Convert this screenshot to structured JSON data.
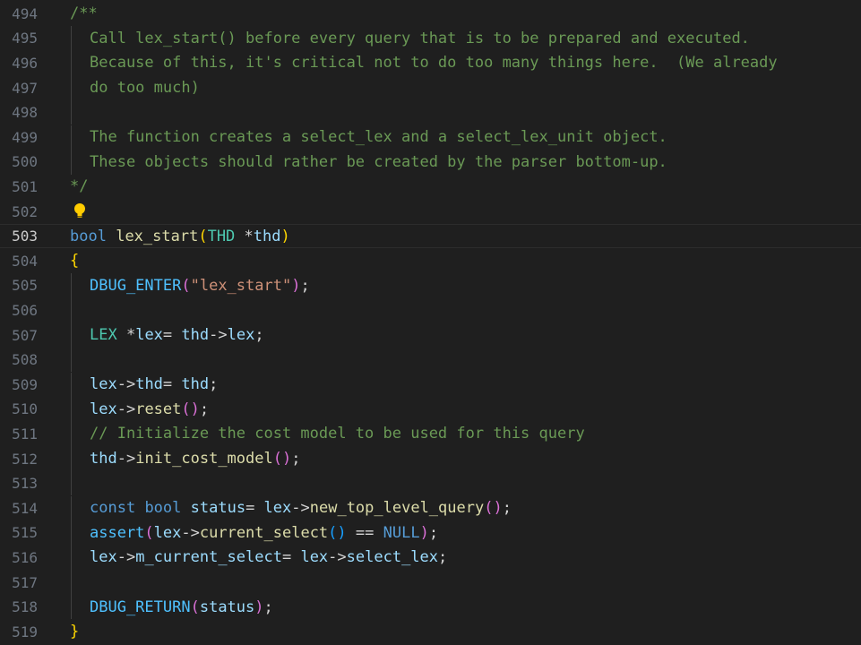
{
  "colors": {
    "background": "#1f1f1f",
    "comment": "#6a9955",
    "keyword": "#569cd6",
    "function": "#dcdcaa",
    "type": "#4ec9b0",
    "variable": "#9cdcfe",
    "string": "#ce9178",
    "punctuation": "#d4d4d4",
    "bracket_level1": "#ffd700",
    "bracket_level2": "#da70d6",
    "bracket_level3": "#179fff",
    "line_number": "#6e7681",
    "line_number_active": "#cccccc"
  },
  "editor": {
    "active_line": "503",
    "lightbulb_icon": "lightbulb-icon",
    "lines": [
      {
        "num": "494",
        "indent": 0,
        "tokens": [
          {
            "t": "/**",
            "c": "comment"
          }
        ]
      },
      {
        "num": "495",
        "indent": 1,
        "tokens": [
          {
            "t": "Call lex_start() before every query that is to be prepared and executed.",
            "c": "comment"
          }
        ]
      },
      {
        "num": "496",
        "indent": 1,
        "tokens": [
          {
            "t": "Because of this, it's critical not to do too many things here.  (We already",
            "c": "comment"
          }
        ]
      },
      {
        "num": "497",
        "indent": 1,
        "tokens": [
          {
            "t": "do too much)",
            "c": "comment"
          }
        ]
      },
      {
        "num": "498",
        "indent": 1,
        "tokens": []
      },
      {
        "num": "499",
        "indent": 1,
        "tokens": [
          {
            "t": "The function creates a select_lex and a select_lex_unit object.",
            "c": "comment"
          }
        ]
      },
      {
        "num": "500",
        "indent": 1,
        "tokens": [
          {
            "t": "These objects should rather be created by the parser bottom-up.",
            "c": "comment"
          }
        ]
      },
      {
        "num": "501",
        "indent": 0,
        "tokens": [
          {
            "t": "*/",
            "c": "comment"
          }
        ]
      },
      {
        "num": "502",
        "indent": 0,
        "bulb": true,
        "tokens": []
      },
      {
        "num": "503",
        "indent": 0,
        "tokens": [
          {
            "t": "bool",
            "c": "kw"
          },
          {
            "t": " ",
            "c": "plain"
          },
          {
            "t": "lex_start",
            "c": "fn"
          },
          {
            "t": "(",
            "c": "brace1"
          },
          {
            "t": "THD",
            "c": "type"
          },
          {
            "t": " *",
            "c": "plain"
          },
          {
            "t": "thd",
            "c": "var"
          },
          {
            "t": ")",
            "c": "brace1"
          }
        ]
      },
      {
        "num": "504",
        "indent": 0,
        "tokens": [
          {
            "t": "{",
            "c": "brace1"
          }
        ]
      },
      {
        "num": "505",
        "indent": 1,
        "tokens": [
          {
            "t": "DBUG_ENTER",
            "c": "macro"
          },
          {
            "t": "(",
            "c": "brace2"
          },
          {
            "t": "\"lex_start\"",
            "c": "str"
          },
          {
            "t": ")",
            "c": "brace2"
          },
          {
            "t": ";",
            "c": "plain"
          }
        ]
      },
      {
        "num": "506",
        "indent": 1,
        "tokens": []
      },
      {
        "num": "507",
        "indent": 1,
        "tokens": [
          {
            "t": "LEX",
            "c": "type"
          },
          {
            "t": " *",
            "c": "plain"
          },
          {
            "t": "lex",
            "c": "var"
          },
          {
            "t": "= ",
            "c": "plain"
          },
          {
            "t": "thd",
            "c": "var"
          },
          {
            "t": "->",
            "c": "plain"
          },
          {
            "t": "lex",
            "c": "var"
          },
          {
            "t": ";",
            "c": "plain"
          }
        ]
      },
      {
        "num": "508",
        "indent": 1,
        "tokens": []
      },
      {
        "num": "509",
        "indent": 1,
        "tokens": [
          {
            "t": "lex",
            "c": "var"
          },
          {
            "t": "->",
            "c": "plain"
          },
          {
            "t": "thd",
            "c": "var"
          },
          {
            "t": "= ",
            "c": "plain"
          },
          {
            "t": "thd",
            "c": "var"
          },
          {
            "t": ";",
            "c": "plain"
          }
        ]
      },
      {
        "num": "510",
        "indent": 1,
        "tokens": [
          {
            "t": "lex",
            "c": "var"
          },
          {
            "t": "->",
            "c": "plain"
          },
          {
            "t": "reset",
            "c": "fn"
          },
          {
            "t": "()",
            "c": "brace2"
          },
          {
            "t": ";",
            "c": "plain"
          }
        ]
      },
      {
        "num": "511",
        "indent": 1,
        "tokens": [
          {
            "t": "// Initialize the cost model to be used for this query",
            "c": "comment"
          }
        ]
      },
      {
        "num": "512",
        "indent": 1,
        "tokens": [
          {
            "t": "thd",
            "c": "var"
          },
          {
            "t": "->",
            "c": "plain"
          },
          {
            "t": "init_cost_model",
            "c": "fn"
          },
          {
            "t": "()",
            "c": "brace2"
          },
          {
            "t": ";",
            "c": "plain"
          }
        ]
      },
      {
        "num": "513",
        "indent": 1,
        "tokens": []
      },
      {
        "num": "514",
        "indent": 1,
        "tokens": [
          {
            "t": "const",
            "c": "kw"
          },
          {
            "t": " ",
            "c": "plain"
          },
          {
            "t": "bool",
            "c": "kw"
          },
          {
            "t": " ",
            "c": "plain"
          },
          {
            "t": "status",
            "c": "var"
          },
          {
            "t": "= ",
            "c": "plain"
          },
          {
            "t": "lex",
            "c": "var"
          },
          {
            "t": "->",
            "c": "plain"
          },
          {
            "t": "new_top_level_query",
            "c": "fn"
          },
          {
            "t": "()",
            "c": "brace2"
          },
          {
            "t": ";",
            "c": "plain"
          }
        ]
      },
      {
        "num": "515",
        "indent": 1,
        "tokens": [
          {
            "t": "assert",
            "c": "macro"
          },
          {
            "t": "(",
            "c": "brace2"
          },
          {
            "t": "lex",
            "c": "var"
          },
          {
            "t": "->",
            "c": "plain"
          },
          {
            "t": "current_select",
            "c": "fn"
          },
          {
            "t": "()",
            "c": "brace3"
          },
          {
            "t": " == ",
            "c": "plain"
          },
          {
            "t": "NULL",
            "c": "kw"
          },
          {
            "t": ")",
            "c": "brace2"
          },
          {
            "t": ";",
            "c": "plain"
          }
        ]
      },
      {
        "num": "516",
        "indent": 1,
        "tokens": [
          {
            "t": "lex",
            "c": "var"
          },
          {
            "t": "->",
            "c": "plain"
          },
          {
            "t": "m_current_select",
            "c": "var"
          },
          {
            "t": "= ",
            "c": "plain"
          },
          {
            "t": "lex",
            "c": "var"
          },
          {
            "t": "->",
            "c": "plain"
          },
          {
            "t": "select_lex",
            "c": "var"
          },
          {
            "t": ";",
            "c": "plain"
          }
        ]
      },
      {
        "num": "517",
        "indent": 1,
        "tokens": []
      },
      {
        "num": "518",
        "indent": 1,
        "tokens": [
          {
            "t": "DBUG_RETURN",
            "c": "macro"
          },
          {
            "t": "(",
            "c": "brace2"
          },
          {
            "t": "status",
            "c": "var"
          },
          {
            "t": ")",
            "c": "brace2"
          },
          {
            "t": ";",
            "c": "plain"
          }
        ]
      },
      {
        "num": "519",
        "indent": 0,
        "tokens": [
          {
            "t": "}",
            "c": "brace1"
          }
        ]
      }
    ]
  }
}
